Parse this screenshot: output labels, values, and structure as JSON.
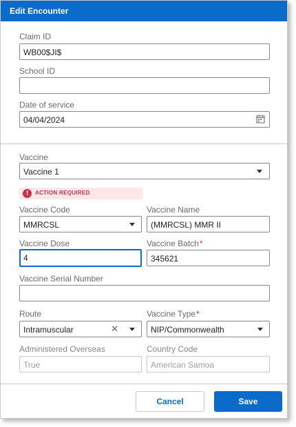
{
  "dialog": {
    "title": "Edit Encounter",
    "accent_color": "#0b6bcb",
    "error_color": "#c4314b"
  },
  "fields": {
    "claim_id": {
      "label": "Claim ID",
      "value": "WB00$JI$"
    },
    "school_id": {
      "label": "School ID",
      "value": ""
    },
    "date_of_service": {
      "label": "Date of service",
      "value": "04/04/2024",
      "icon": "calendar-icon"
    },
    "vaccine": {
      "label": "Vaccine",
      "value": "Vaccine 1"
    },
    "alert": {
      "icon": "alert-icon",
      "glyph": "!",
      "text": "ACTION REQUIRED"
    },
    "vaccine_code": {
      "label": "Vaccine Code",
      "value": "MMRCSL"
    },
    "vaccine_name": {
      "label": "Vaccine Name",
      "value": "(MMRCSL) MMR II"
    },
    "vaccine_dose": {
      "label": "Vaccine Dose",
      "value": "4"
    },
    "vaccine_batch": {
      "label": "Vaccine Batch",
      "required_mark": "*",
      "value": "345621"
    },
    "vaccine_serial_number": {
      "label": "Vaccine Serial Number",
      "value": ""
    },
    "route": {
      "label": "Route",
      "value": "Intramuscular",
      "clear_glyph": "✕"
    },
    "vaccine_type": {
      "label": "Vaccine Type",
      "required_mark": "*",
      "value": "NIP/Commonwealth"
    },
    "administered_overseas": {
      "label": "Administered Overseas",
      "value": "True"
    },
    "country_code": {
      "label": "Country Code",
      "value": "American Samoa"
    }
  },
  "footer": {
    "cancel_label": "Cancel",
    "save_label": "Save"
  }
}
